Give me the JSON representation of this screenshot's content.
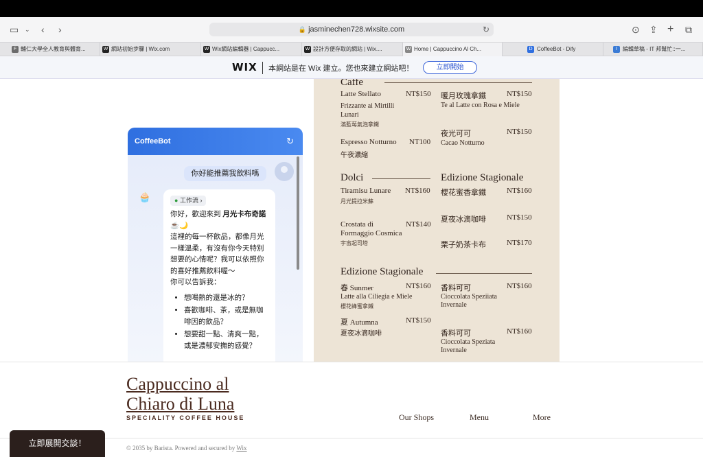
{
  "browser": {
    "url": "jasminechen728.wixsite.com",
    "tabs": [
      {
        "label": "輔仁大學全人教育與體育...",
        "favicon": "F"
      },
      {
        "label": "網站初始步驟 | Wix.com",
        "favicon": "W"
      },
      {
        "label": "Wix網站編輯器 | Cappucc...",
        "favicon": "W"
      },
      {
        "label": "設計方便存取的網站 | Wix....",
        "favicon": "W"
      },
      {
        "label": "Home | Cappuccino Al Ch...",
        "favicon": "W"
      },
      {
        "label": "CoffeeBot - Dify",
        "favicon": "D"
      },
      {
        "label": "編輯草稿 - IT 邦幫忙::一...",
        "favicon": "I"
      }
    ]
  },
  "wix_banner": {
    "logo": "WIX",
    "text": "本網站是在 Wix 建立。您也來建立網站吧！",
    "button": "立即開始"
  },
  "chatbot": {
    "title": "CoffeeBot",
    "user_message": "你好能推薦我飲料嗎",
    "workflow_label": "工作流",
    "bot_intro_1": "你好，歡迎來到",
    "bot_intro_bold": "月光卡布奇諾",
    "bot_intro_emoji": "☕🌙",
    "bot_text": "這裡的每一杯飲品，都像月光一樣溫柔，有沒有你今天特別想要的心情呢？我可以依照你的喜好推薦飲料喔～",
    "bot_prompt": "你可以告訴我：",
    "bot_options": [
      "想喝熱的還是冰的？",
      "喜歡咖啡、茶，或是無咖啡因的飲品？",
      "想要甜一點、清爽一點，或是濃郁安撫的感覺？"
    ],
    "open_button": "立即展開交談！"
  },
  "menu": {
    "sections": [
      {
        "title": "Caffe",
        "items": [
          {
            "name": "Latte Stellato",
            "price": "NT$150",
            "desc": "Frizzante ai Mirtilli Lunari",
            "zh": "滿藍莓氣泡拿鐵"
          },
          {
            "name": "Espresso Notturno",
            "price": "NT100",
            "desc": "",
            "zh": "午夜濃縮"
          }
        ]
      },
      {
        "title": "Dolci",
        "items": [
          {
            "name": "Tiramisu Lunare",
            "price": "NT$160",
            "desc": "",
            "zh": "月光提拉米蘇"
          },
          {
            "name": "Crostata di Formaggio Cosmica",
            "price": "NT$140",
            "desc": "",
            "zh": "宇宙起司塔"
          }
        ]
      },
      {
        "title": "Edizione Stagionale",
        "items": [
          {
            "name": "春 Sunmer",
            "price": "NT$160",
            "desc": "Latte alla Ciliegia e Miele",
            "zh": "櫻花蜂蜜拿鐵"
          },
          {
            "name": "夏 Autumna",
            "price": "NT$150",
            "desc": "夏夜冰滴咖啡",
            "zh": ""
          }
        ]
      }
    ],
    "right_col": [
      {
        "name": "暖月玫瑰拿鐵",
        "price": "NT$150",
        "desc": "Te al Latte con Rosa e Miele"
      },
      {
        "name": "夜光可可",
        "price": "NT$150",
        "desc": "Cacao Notturno"
      },
      {
        "name": "櫻花蜜香拿鐵",
        "price": "NT$160",
        "desc": ""
      },
      {
        "name": "夏夜冰滴咖啡",
        "price": "NT$150",
        "desc": ""
      },
      {
        "name": "栗子奶茶卡布",
        "price": "NT$170",
        "desc": ""
      },
      {
        "name": "香料可可",
        "price": "NT$160",
        "desc": "Cioccolata Speziiata Invernale"
      },
      {
        "name": "香料可可",
        "price": "NT$160",
        "desc": "Cioccolata Speziata Invernale"
      }
    ],
    "right_section_title": "Edizione Stagionale"
  },
  "site": {
    "brand_line1": "Cappuccino al",
    "brand_line2": "Chiaro di Luna",
    "tagline": "SPECIALITY COFFEE HOUSE",
    "nav": [
      "Our Shops",
      "Menu",
      "More"
    ],
    "copyright": "© 2035 by Barista. Powered and secured by",
    "copyright_link": "Wix"
  },
  "colors": {
    "accent": "#2f6fe0",
    "brand": "#4a2a1f",
    "wix_blue": "#2c55d0"
  }
}
